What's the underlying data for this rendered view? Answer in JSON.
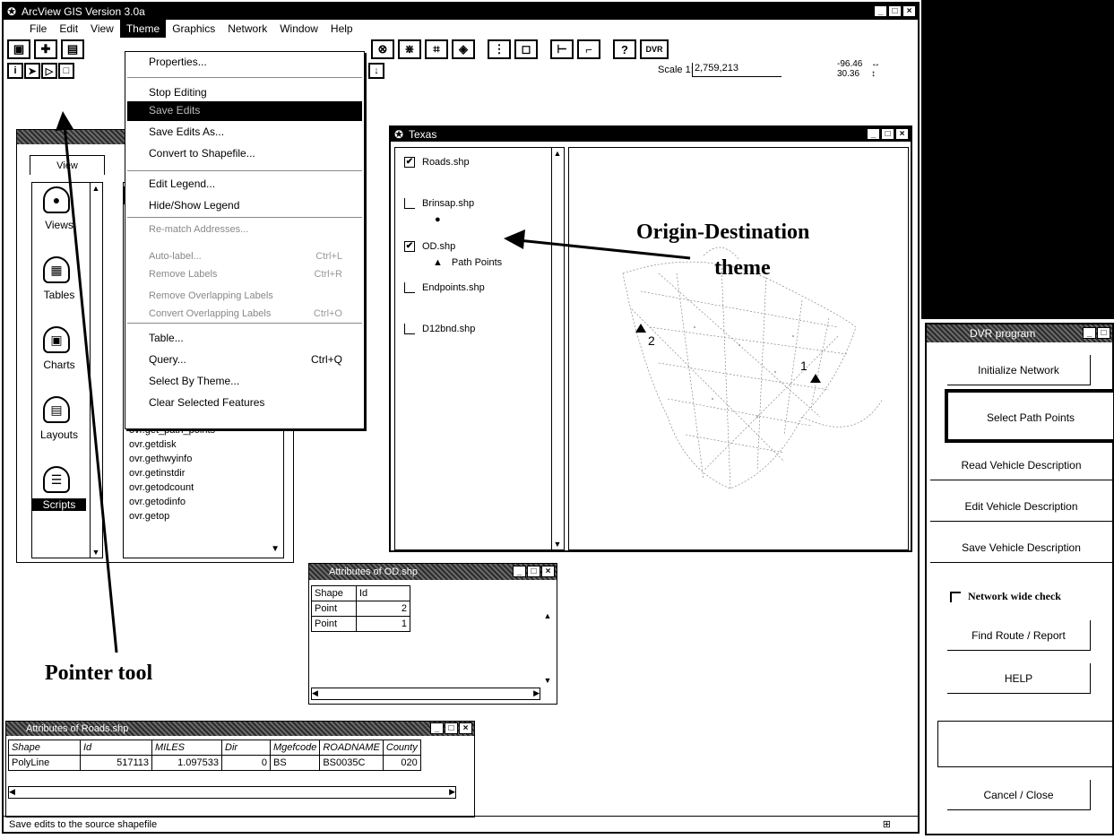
{
  "main_window": {
    "title": "ArcView GIS Version 3.0a",
    "menus": [
      "File",
      "Edit",
      "View",
      "Theme",
      "Graphics",
      "Network",
      "Window",
      "Help"
    ],
    "active_menu": "Theme",
    "scale_label": "Scale 1:",
    "scale_value": "2,759,213",
    "coord_x": "-96.46",
    "coord_y": "30.36",
    "dvr_label": "DVR",
    "status_text": "Save edits to the source shapefile"
  },
  "theme_menu": {
    "items": [
      {
        "label": "Properties...",
        "shortcut": "",
        "enabled": true
      },
      {
        "label": "Stop Editing",
        "shortcut": "",
        "enabled": true
      },
      {
        "label": "Save Edits",
        "shortcut": "",
        "enabled": true,
        "highlighted": true
      },
      {
        "label": "Save Edits As...",
        "shortcut": "",
        "enabled": true
      },
      {
        "label": "Convert to Shapefile...",
        "shortcut": "",
        "enabled": true
      },
      {
        "label": "Edit Legend...",
        "shortcut": "",
        "enabled": true
      },
      {
        "label": "Hide/Show Legend",
        "shortcut": "",
        "enabled": true
      },
      {
        "label": "Re-match Addresses...",
        "shortcut": "",
        "enabled": false
      },
      {
        "label": "Auto-label...",
        "shortcut": "Ctrl+L",
        "enabled": false
      },
      {
        "label": "Remove Labels",
        "shortcut": "Ctrl+R",
        "enabled": false
      },
      {
        "label": "Remove Overlapping Labels",
        "shortcut": "",
        "enabled": false
      },
      {
        "label": "Convert Overlapping Labels",
        "shortcut": "Ctrl+O",
        "enabled": false
      },
      {
        "label": "Table...",
        "shortcut": "",
        "enabled": true
      },
      {
        "label": "Query...",
        "shortcut": "Ctrl+Q",
        "enabled": true
      },
      {
        "label": "Select By Theme...",
        "shortcut": "",
        "enabled": true
      },
      {
        "label": "Clear Selected Features",
        "shortcut": "",
        "enabled": true
      }
    ]
  },
  "project": {
    "tab_label": "View",
    "icons": [
      {
        "label": "Views"
      },
      {
        "label": "Tables"
      },
      {
        "label": "Charts"
      },
      {
        "label": "Layouts"
      },
      {
        "label": "Scripts"
      }
    ],
    "scripts": [
      "ovr.get_path_points",
      "ovr.getdisk",
      "ovr.gethwyinfo",
      "ovr.getinstdir",
      "ovr.getodcount",
      "ovr.getodinfo",
      "ovr.getop"
    ]
  },
  "texas_view": {
    "title": "Texas",
    "themes": [
      {
        "name": "Roads.shp",
        "checked": true,
        "symbol": ""
      },
      {
        "name": "Brinsap.shp",
        "checked": false,
        "symbol": "●"
      },
      {
        "name": "OD.shp",
        "checked": true,
        "symbol": "▲",
        "symbol_label": "Path Points"
      },
      {
        "name": "Endpoints.shp",
        "checked": false,
        "symbol": ""
      },
      {
        "name": "D12bnd.shp",
        "checked": false,
        "symbol": ""
      }
    ],
    "point_labels": [
      "2",
      "1"
    ]
  },
  "od_table": {
    "title": "Attributes of OD.shp",
    "columns": [
      "Shape",
      "Id"
    ],
    "rows": [
      [
        "Point",
        "2"
      ],
      [
        "Point",
        "1"
      ]
    ]
  },
  "roads_table": {
    "title": "Attributes of Roads.shp",
    "columns": [
      "Shape",
      "Id",
      "MILES",
      "Dir",
      "Mgefcode",
      "ROADNAME",
      "County"
    ],
    "rows": [
      [
        "PolyLine",
        "517113",
        "1.097533",
        "0",
        "BS",
        "BS0035C",
        "020"
      ]
    ]
  },
  "dvr_panel": {
    "title": "DVR program",
    "buttons": [
      "Initialize Network",
      "Select Path Points",
      "Read Vehicle Description",
      "Edit Vehicle Description",
      "Save Vehicle Description"
    ],
    "checkbox_label": "Network wide check",
    "buttons2": [
      "Find Route / Report",
      "HELP"
    ],
    "cancel_label": "Cancel / Close"
  },
  "annotations": {
    "od_theme_line1": "Origin-Destination",
    "od_theme_line2": "theme",
    "pointer_tool": "Pointer tool"
  },
  "colors": {
    "background": "#ffffff",
    "black": "#000000",
    "menu_highlight": "#000000"
  }
}
